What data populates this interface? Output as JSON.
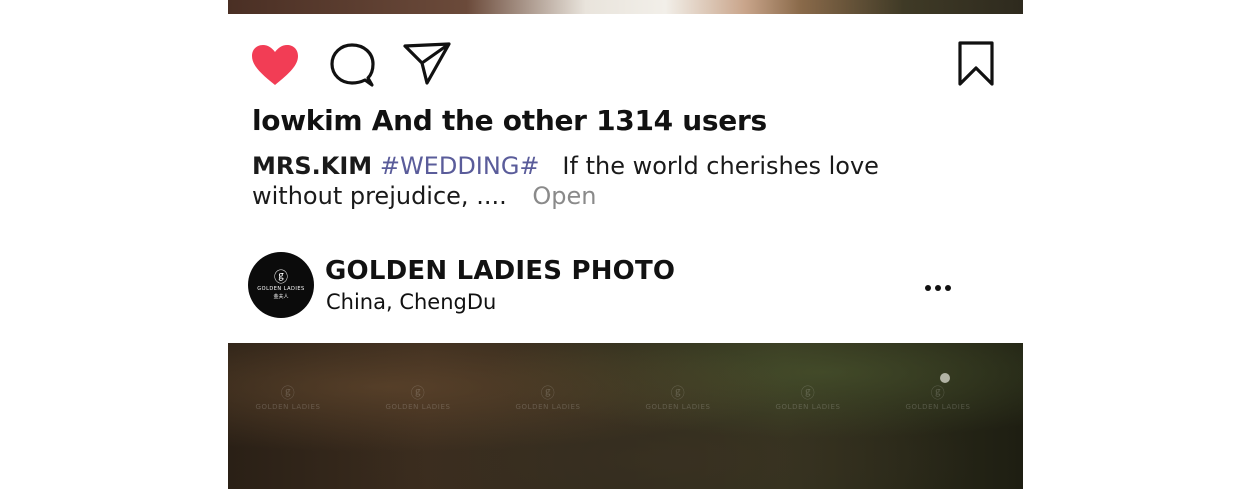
{
  "post": {
    "likes_text": "lowkim And the other 1314 users",
    "caption": {
      "author": "MRS.KIM",
      "hashtag": "#WEDDING#",
      "text": "If the world cherishes love without prejudice, ....",
      "more": "Open"
    }
  },
  "next_post": {
    "avatar": {
      "mark": "ⓖ",
      "brand": "GOLDEN LADIES",
      "sub": "金夫人"
    },
    "account_name": "GOLDEN LADIES PHOTO",
    "location": "China,  ChengDu",
    "watermark": {
      "mark": "ⓖ",
      "brand": "GOLDEN LADIES",
      "sub": "金夫人"
    }
  },
  "icons": {
    "like": "heart-icon",
    "comment": "comment-icon",
    "share": "send-icon",
    "save": "bookmark-icon",
    "more": "more-options-icon"
  },
  "colors": {
    "like_active": "#f23d55",
    "hashtag": "#5a5c9a",
    "more_link": "#8a8a8a",
    "avatar_bg": "#0b0b0b"
  }
}
